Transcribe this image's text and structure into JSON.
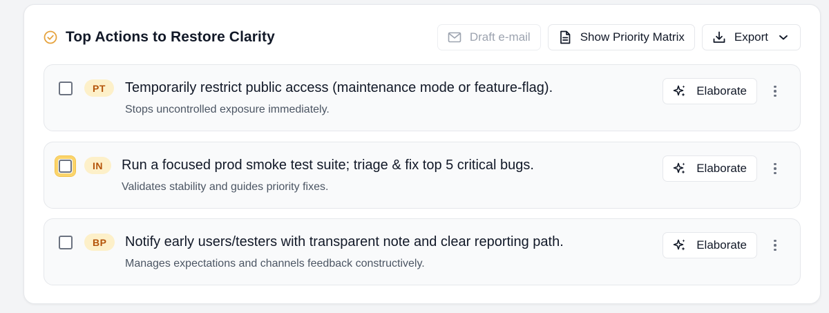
{
  "header": {
    "title": "Top Actions to Restore Clarity",
    "title_icon": "check-circle-icon",
    "accent_color": "#e6a23c"
  },
  "toolbar": {
    "draft_email": {
      "label": "Draft e-mail",
      "icon": "mail-icon",
      "disabled": true
    },
    "priority_matrix": {
      "label": "Show Priority Matrix",
      "icon": "document-icon"
    },
    "export": {
      "label": "Export",
      "icon": "download-icon",
      "caret": "chevron-down-icon"
    }
  },
  "items": [
    {
      "badge": "PT",
      "title": "Temporarily restrict public access (maintenance mode or feature-flag).",
      "subtitle": "Stops uncontrolled exposure immediately.",
      "checked": false,
      "focused": false,
      "action_label": "Elaborate"
    },
    {
      "badge": "IN",
      "title": "Run a focused prod smoke test suite; triage & fix top 5 critical bugs.",
      "subtitle": "Validates stability and guides priority fixes.",
      "checked": false,
      "focused": true,
      "action_label": "Elaborate"
    },
    {
      "badge": "BP",
      "title": "Notify early users/testers with transparent note and clear reporting path.",
      "subtitle": "Manages expectations and channels feedback constructively.",
      "checked": false,
      "focused": false,
      "action_label": "Elaborate"
    }
  ],
  "colors": {
    "badge_bg": "#fdf0c9",
    "badge_text": "#b45309",
    "focus_ring": "#fbd46a"
  }
}
